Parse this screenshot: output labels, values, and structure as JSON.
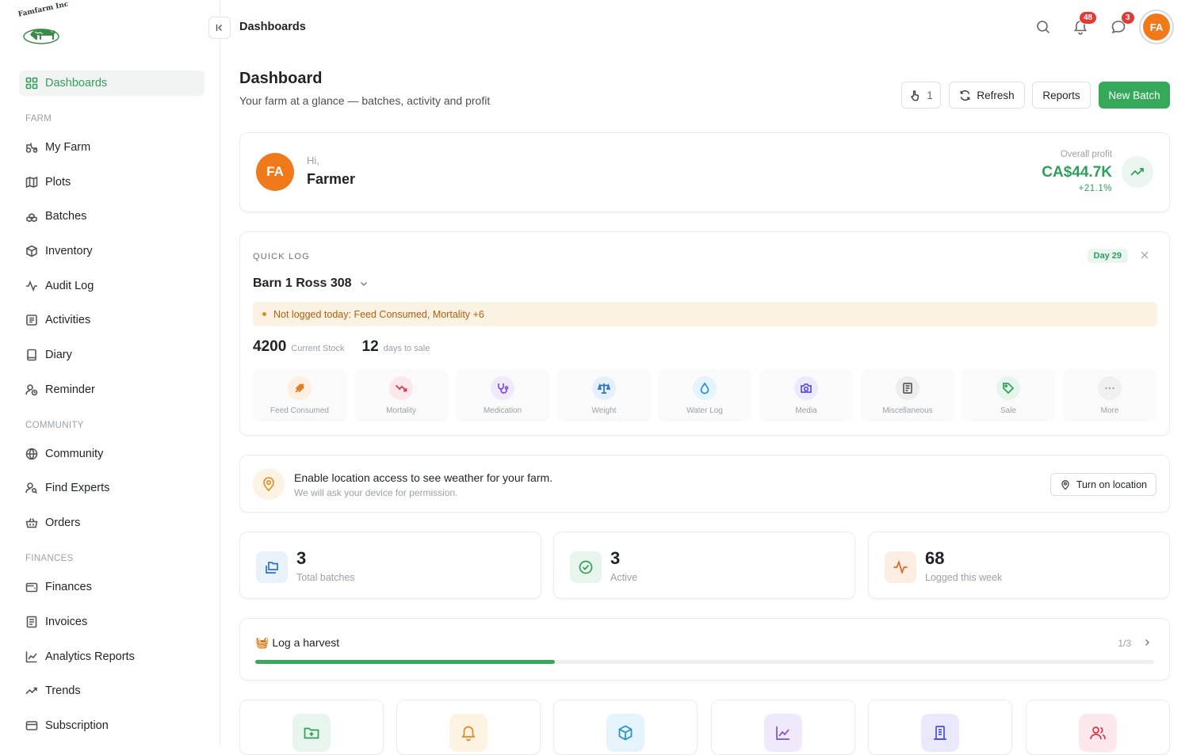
{
  "brand": {
    "logo_text": "Famfarm Inc"
  },
  "sidebar": {
    "active_item": {
      "label": "Dashboards",
      "icon": "grid-icon"
    },
    "sections": {
      "farm": "FARM",
      "community": "COMMUNITY",
      "finances": "FINANCES"
    },
    "farm_items": [
      {
        "label": "My Farm",
        "icon": "tractor-icon"
      },
      {
        "label": "Plots",
        "icon": "map-icon"
      },
      {
        "label": "Batches",
        "icon": "boxes-icon"
      },
      {
        "label": "Inventory",
        "icon": "package-icon"
      },
      {
        "label": "Audit Log",
        "icon": "activity-icon"
      },
      {
        "label": "Activities",
        "icon": "list-icon"
      },
      {
        "label": "Diary",
        "icon": "book-icon"
      },
      {
        "label": "Reminder",
        "icon": "user-clock-icon"
      }
    ],
    "community_items": [
      {
        "label": "Community",
        "icon": "globe-icon"
      },
      {
        "label": "Find Experts",
        "icon": "user-search-icon"
      },
      {
        "label": "Orders",
        "icon": "basket-icon"
      }
    ],
    "finance_items": [
      {
        "label": "Finances",
        "icon": "wallet-icon"
      },
      {
        "label": "Invoices",
        "icon": "receipt-icon"
      },
      {
        "label": "Analytics Reports",
        "icon": "chart-line-icon"
      },
      {
        "label": "Trends",
        "icon": "trending-up-icon"
      },
      {
        "label": "Subscription",
        "icon": "credit-card-icon"
      }
    ]
  },
  "topbar": {
    "title": "Dashboards",
    "notifications_count": "48",
    "messages_count": "3",
    "avatar_initials": "FA"
  },
  "header": {
    "title": "Dashboard",
    "subtitle": "Your farm at a glance — batches, activity and profit",
    "counter_value": "1",
    "refresh_label": "Refresh",
    "reports_label": "Reports",
    "new_batch_label": "New Batch"
  },
  "greeting": {
    "initials": "FA",
    "hi": "Hi,",
    "name": "Farmer",
    "profit_label": "Overall profit",
    "profit_value": "CA$44.7K",
    "profit_change": "+21.1%"
  },
  "quick_log": {
    "label": "QUICK LOG",
    "day_badge": "Day 29",
    "batch_name": "Barn 1 Ross 308",
    "warning": "Not logged today: Feed Consumed, Mortality +6",
    "stock_value": "4200",
    "stock_label": "Current Stock",
    "days_value": "12",
    "days_label": "days to sale",
    "tiles": [
      {
        "label": "Feed Consumed",
        "icon": "wheat-icon",
        "color": "#e07b1a",
        "bg": "#fdf0e2"
      },
      {
        "label": "Mortality",
        "icon": "trending-down-icon",
        "color": "#d9344a",
        "bg": "#fce8ea"
      },
      {
        "label": "Medication",
        "icon": "stethoscope-icon",
        "color": "#7a4fd6",
        "bg": "#efe9fb"
      },
      {
        "label": "Weight",
        "icon": "scale-icon",
        "color": "#2a72c9",
        "bg": "#e6f0fb"
      },
      {
        "label": "Water Log",
        "icon": "droplet-icon",
        "color": "#2a8fc9",
        "bg": "#e5f3fb"
      },
      {
        "label": "Media",
        "icon": "camera-icon",
        "color": "#5a4fd6",
        "bg": "#ebe9fb"
      },
      {
        "label": "Miscellaneous",
        "icon": "receipt-icon",
        "color": "#555a60",
        "bg": "#ededee"
      },
      {
        "label": "Sale",
        "icon": "tag-icon",
        "color": "#2f9e5a",
        "bg": "#e6f5ec"
      },
      {
        "label": "More",
        "icon": "more-icon",
        "color": "#9aa0a6",
        "bg": "#f0f0f1"
      }
    ]
  },
  "location": {
    "title": "Enable location access to see weather for your farm.",
    "subtitle": "We will ask your device for permission.",
    "button_label": "Turn on location"
  },
  "stats": [
    {
      "value": "3",
      "label": "Total batches",
      "icon": "folders-icon",
      "color": "#2a72c9",
      "bg": "#e9f1fb"
    },
    {
      "value": "3",
      "label": "Active",
      "icon": "check-circle-icon",
      "color": "#2f9e5a",
      "bg": "#e8f5ed"
    },
    {
      "value": "68",
      "label": "Logged this week",
      "icon": "activity-icon",
      "color": "#e0661a",
      "bg": "#fdeee4"
    }
  ],
  "harvest": {
    "title": "🧺 Log a harvest",
    "pager": "1/3",
    "progress": 0.333
  },
  "shortcuts": [
    {
      "icon": "folder-plus-icon",
      "color": "#2f9e5a",
      "bg": "#e8f5ed"
    },
    {
      "icon": "bell-icon",
      "color": "#e08a1a",
      "bg": "#fdf3e2"
    },
    {
      "icon": "package-icon",
      "color": "#2a8fc9",
      "bg": "#e5f3fb"
    },
    {
      "icon": "chart-line-icon",
      "color": "#7a4fd6",
      "bg": "#efe9fb"
    },
    {
      "icon": "building-icon",
      "color": "#4a4fd6",
      "bg": "#e9e9fb"
    },
    {
      "icon": "users-icon",
      "color": "#d9344a",
      "bg": "#fce8ea"
    }
  ]
}
